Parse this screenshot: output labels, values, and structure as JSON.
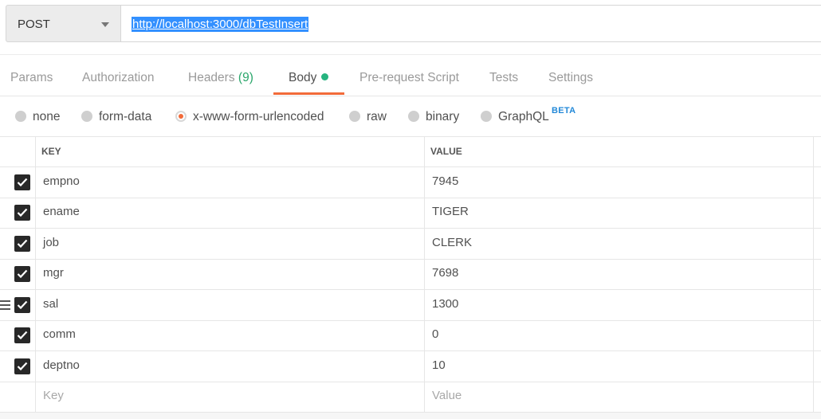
{
  "request": {
    "method": "POST",
    "url": "http://localhost:3000/dbTestInsert"
  },
  "tabs": [
    {
      "label": "Params"
    },
    {
      "label": "Authorization"
    },
    {
      "label": "Headers",
      "count": "(9)"
    },
    {
      "label": "Body",
      "active": true
    },
    {
      "label": "Pre-request Script"
    },
    {
      "label": "Tests"
    },
    {
      "label": "Settings"
    }
  ],
  "body_types": {
    "options": [
      "none",
      "form-data",
      "x-www-form-urlencoded",
      "raw",
      "binary",
      "GraphQL"
    ],
    "selected": "x-www-form-urlencoded",
    "beta_badge": "BETA"
  },
  "table": {
    "headers": {
      "key": "KEY",
      "value": "VALUE"
    },
    "rows": [
      {
        "key": "empno",
        "value": "7945",
        "checked": true
      },
      {
        "key": "ename",
        "value": "TIGER",
        "checked": true
      },
      {
        "key": "job",
        "value": "CLERK",
        "checked": true
      },
      {
        "key": "mgr",
        "value": "7698",
        "checked": true
      },
      {
        "key": "sal",
        "value": "1300",
        "checked": true
      },
      {
        "key": "comm",
        "value": "0",
        "checked": true
      },
      {
        "key": "deptno",
        "value": "10",
        "checked": true
      }
    ],
    "new_row": {
      "key_placeholder": "Key",
      "value_placeholder": "Value"
    }
  },
  "colors": {
    "accent": "#f26b3a",
    "status_green": "#26b47f",
    "beta_blue": "#2389d8",
    "selection_blue": "#3390ff"
  }
}
